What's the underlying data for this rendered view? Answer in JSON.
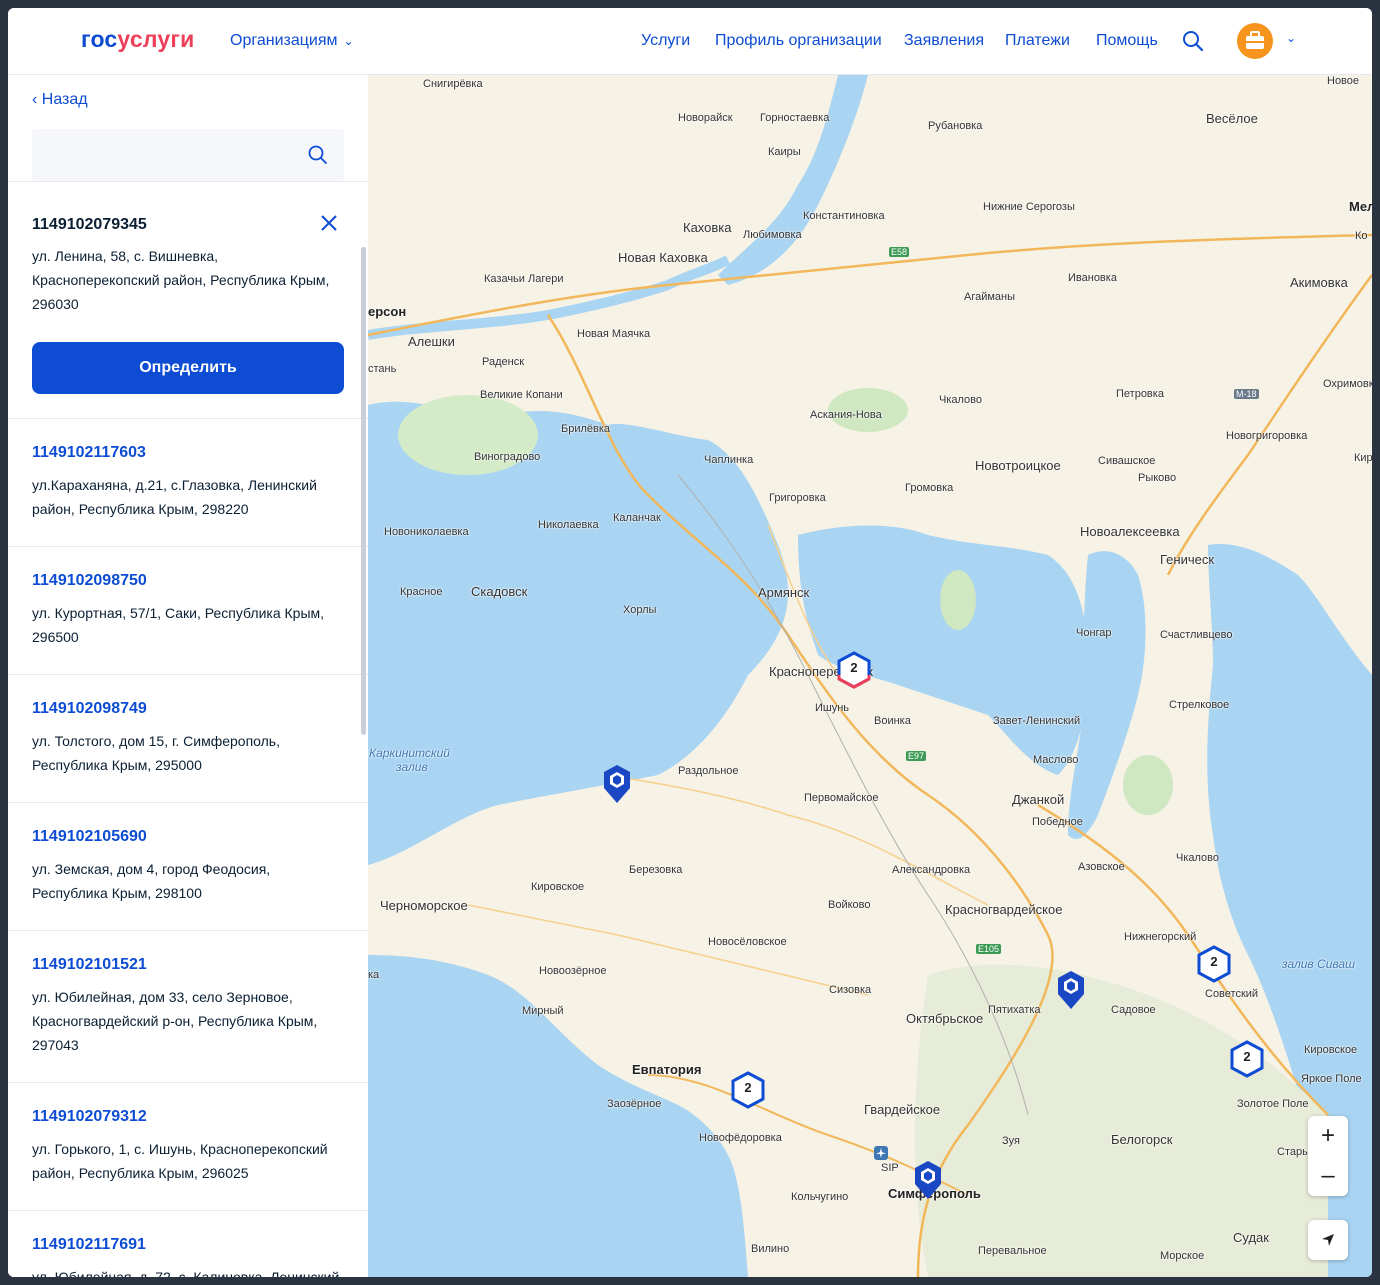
{
  "header": {
    "logo_part1": "гос",
    "logo_part2": "услуги",
    "org_label": "Организациям",
    "nav": [
      "Услуги",
      "Профиль организации",
      "Заявления",
      "Платежи",
      "Помощь"
    ]
  },
  "sidebar": {
    "back_label": "Назад",
    "search_placeholder": "",
    "selected": {
      "code": "1149102079345",
      "address": "ул. Ленина, 58, с. Вишневка, Красноперекопский район, Республика Крым, 296030",
      "button_label": "Определить"
    },
    "items": [
      {
        "code": "1149102117603",
        "address": "ул.Караханяна, д.21, с.Глазовка, Ленинский район, Республика Крым, 298220"
      },
      {
        "code": "1149102098750",
        "address": "ул. Курортная, 57/1, Саки, Республика Крым, 296500"
      },
      {
        "code": "1149102098749",
        "address": "ул. Толстого, дом 15, г. Симферополь, Республика Крым, 295000"
      },
      {
        "code": "1149102105690",
        "address": "ул. Земская, дом 4, город Феодосия, Республика Крым, 298100"
      },
      {
        "code": "1149102101521",
        "address": "ул. Юбилейная, дом 33, село Зерновое, Красногвардейский р-он, Республика Крым, 297043"
      },
      {
        "code": "1149102079312",
        "address": "ул. Горького, 1, с. Ишунь, Красноперекопский район, Республика Крым, 296025"
      },
      {
        "code": "1149102117691",
        "address": "ул. Юбилейная, д. 72, с. Калиновка, Ленинский"
      }
    ]
  },
  "map": {
    "labels": {
      "snigirevka": "Снигирёвка",
      "novorayisk": "Новорайск",
      "gornostaevka": "Горностаевка",
      "rubanovka": "Рубановка",
      "veseloe": "Весёлое",
      "kairy": "Каиры",
      "nizhnie_serogozy": "Нижние Серогозы",
      "konstantinovka": "Константиновка",
      "kakhovka": "Каховка",
      "lyubimovka": "Любимовка",
      "novaya_kakhovka": "Новая Каховка",
      "kazachi_lageri": "Казачьи Лагери",
      "ivanovka": "Ивановка",
      "agaimany": "Агайманы",
      "akimovka": "Акимовка",
      "kherson": "ерсон",
      "aleshki": "Алешки",
      "novaya_mayachka": "Новая Маячка",
      "radensk": "Раденск",
      "stan": "стань",
      "velikie_kopani": "Великие Копани",
      "askaniya": "Аскания-Нова",
      "chkalovo1": "Чкалово",
      "petrovka": "Петровка",
      "ohrimovka": "Охримовк",
      "brilevka": "Брилёвка",
      "vinogradovo": "Виноградово",
      "chaplinka": "Чаплинка",
      "novotroitskoe": "Новотроицкое",
      "sivashskoe": "Сивашское",
      "novogrigorovka": "Новогригоровка",
      "kiril": "Кирил",
      "rykovo": "Рыково",
      "gromovka": "Громовка",
      "grigorovka": "Григоровка",
      "novonikolaevka": "Новониколаевка",
      "nikolaevka": "Николаевка",
      "kalanchak": "Каланчак",
      "novoalekseevka": "Новоалексеевка",
      "genichesk": "Геническ",
      "krasnoe": "Красное",
      "skadovsk": "Скадовск",
      "armyansk": "Армянск",
      "khorly": "Хорлы",
      "chongar": "Чонгар",
      "schastlivtsevo": "Счастливцево",
      "krasnoperekopsk": "Красноперекопск",
      "ishun": "Ишунь",
      "voinka": "Воинка",
      "strelkovoe": "Стрелковое",
      "zavet_leninsky": "Завет-Ленинский",
      "karkinit": "Каркинитский",
      "zaliv": "залив",
      "razdolnoe": "Раздольное",
      "maslovo": "Маслово",
      "pervomayskoe": "Первомайское",
      "dzhankoy": "Джанкой",
      "pobednoe": "Победное",
      "berezovka": "Березовка",
      "kirovskoe1": "Кировское",
      "aleksandrovka": "Александровка",
      "azovskoe": "Азовское",
      "chkalovo2": "Чкалово",
      "chernomorskoe": "Черноморское",
      "voykovo": "Войково",
      "krasnogvardeyskoe": "Красногвардейское",
      "novoselovskoe": "Новосёловское",
      "nizhnegorsky": "Нижнегорский",
      "zaliv_sivash": "залив Сиваш",
      "novoozernoe": "Новоозёрное",
      "sizovka": "Сизовка",
      "pyatikhatka": "Пятихатка",
      "sadovoe": "Садовое",
      "sovetsky": "Советский",
      "oktyabrskoe": "Октябрьское",
      "mirny": "Мирный",
      "kirovskoe2": "Кировское",
      "yarkoe_pole": "Яркое Поле",
      "evpatoriya": "Евпатория",
      "zaozernoe": "Заозёрное",
      "gvardeyskoe": "Гвардейское",
      "zolotoe_pole": "Золотое Поле",
      "novofedorovka": "Новофёдоровка",
      "zuya": "Зуя",
      "belogorsk": "Белогорск",
      "stary_krym": "Старый Кр",
      "sip": "SIP",
      "simferopol": "Симферополь",
      "kolchugino": "Кольчугино",
      "vilino": "Вилино",
      "perevalnoe": "Перевальное",
      "morskoe": "Морское",
      "sudak": "Судак",
      "mel": "Мел",
      "ko": "Ко",
      "novoe": "Новое",
      "ka": "ка"
    },
    "roads": {
      "e58": "E58",
      "e97": "E97",
      "e105": "E105",
      "m18": "M-18"
    },
    "clusters": {
      "c1": "2",
      "c2": "2",
      "c3": "2",
      "c4": "2"
    }
  }
}
